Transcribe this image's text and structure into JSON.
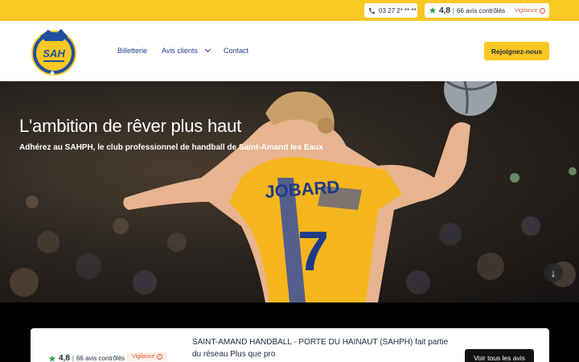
{
  "topbar": {
    "phone": "03 27 2* ** **",
    "rating_score": "4,8",
    "rating_count": "66 avis contrôlés",
    "vigilance": "Vigilance"
  },
  "header": {
    "logo_text": "SAH",
    "nav": [
      {
        "label": "Billetterie"
      },
      {
        "label": "Avis clients"
      },
      {
        "label": "Contact"
      }
    ],
    "cta": "Rejoignez-nous"
  },
  "hero": {
    "title": "L'ambition de rêver plus haut",
    "subtitle": "Adhérez au SAHPH, le club professionnel de handball de Saint-Amand les Eaux",
    "jersey_text": "JOBARD",
    "jersey_number": "7"
  },
  "card": {
    "rating_score": "4,8",
    "rating_count": "66 avis contrôlés",
    "vigilance": "Vigilance",
    "text": "SAINT-AMAND HANDBALL - PORTE DU HAINAUT (SAHPH) fait partie du réseau Plus que pro",
    "button": "Voir tous les avis"
  },
  "colors": {
    "brand_yellow": "#f9c823",
    "nav_blue": "#1f3a8a",
    "vigilance_orange": "#e35a34"
  }
}
